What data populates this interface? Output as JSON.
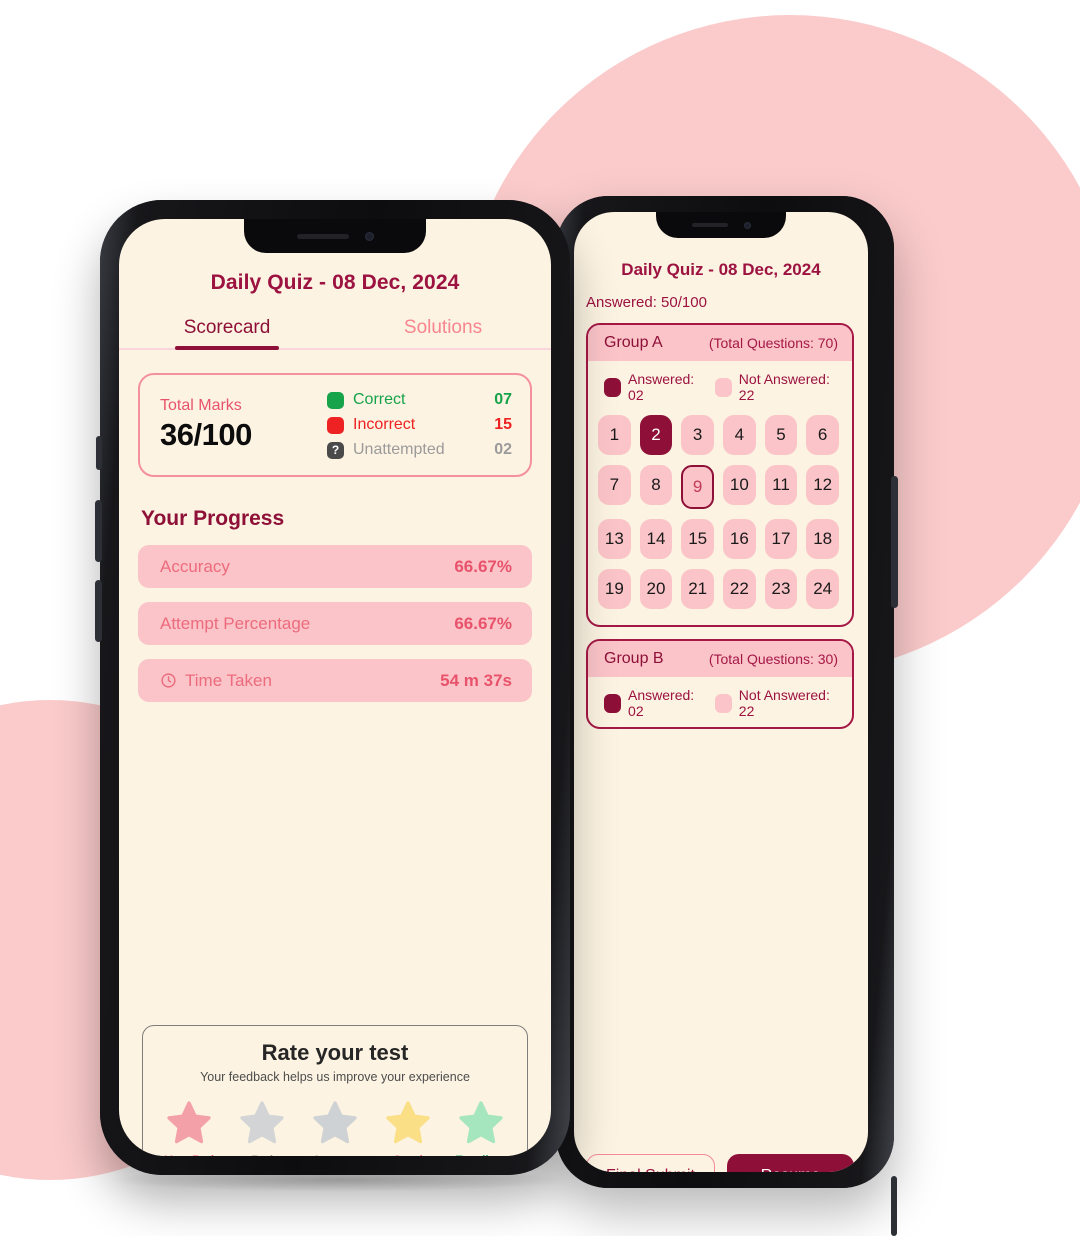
{
  "theme": {
    "brand_maroon": "#8E1038",
    "brand_pink": "#FBC4C9",
    "screen_bg": "#FCF3E2",
    "circle_pink": "#FBCBCB",
    "correct_green": "#16A34A",
    "incorrect_red": "#EE2222",
    "unattempted_gray": "#9A9A9A"
  },
  "scorecard_screen": {
    "title": "Daily Quiz - 08 Dec, 2024",
    "tabs": [
      {
        "label": "Scorecard",
        "active": true
      },
      {
        "label": "Solutions",
        "active": false
      }
    ],
    "score_card": {
      "total_marks_label": "Total Marks",
      "total_marks_value": "36/100",
      "legend": [
        {
          "label": "Correct",
          "count": "07",
          "color": "#16A34A",
          "icon": "filled-square-icon"
        },
        {
          "label": "Incorrect",
          "count": "15",
          "color": "#EE2222",
          "icon": "filled-square-icon"
        },
        {
          "label": "Unattempted",
          "count": "02",
          "color": "#9A9A9A",
          "icon": "question-mark-icon"
        }
      ]
    },
    "progress": {
      "section_title": "Your Progress",
      "rows": [
        {
          "label": "Accuracy",
          "value": "66.67%",
          "icon": null
        },
        {
          "label": "Attempt Percentage",
          "value": "66.67%",
          "icon": null
        },
        {
          "label": "Time Taken",
          "value": "54 m 37s",
          "icon": "clock-icon"
        }
      ]
    },
    "rating": {
      "title": "Rate your test",
      "subtitle": "Your feedback helps us improve your experience",
      "options": [
        {
          "label": "Very Bad",
          "star_color": "#F4A0A8",
          "text_color": "#F4536B"
        },
        {
          "label": "Bad",
          "star_color": "#D2D4D6",
          "text_color": "#9B9B9B"
        },
        {
          "label": "Average",
          "star_color": "#CFD2D4",
          "text_color": "#9B9B9B"
        },
        {
          "label": "Good",
          "star_color": "#FADF86",
          "text_color": "#EE6B7E"
        },
        {
          "label": "Excellent",
          "star_color": "#A5E6BE",
          "text_color": "#2FA86B"
        }
      ]
    }
  },
  "question_palette_screen": {
    "title": "Daily Quiz - 08 Dec, 2024",
    "answered_summary": "Answered: 50/100",
    "groups": [
      {
        "name": "Group A",
        "total_questions": "(Total Questions: 70)",
        "legend": [
          {
            "label": "Answered: 02",
            "swatch": "dark"
          },
          {
            "label": "Not Answered: 22",
            "swatch": "pink"
          }
        ],
        "questions": [
          {
            "n": "1",
            "state": "pink"
          },
          {
            "n": "2",
            "state": "selected"
          },
          {
            "n": "3",
            "state": "pink"
          },
          {
            "n": "4",
            "state": "pink"
          },
          {
            "n": "5",
            "state": "pink"
          },
          {
            "n": "6",
            "state": "pink"
          },
          {
            "n": "7",
            "state": "pink"
          },
          {
            "n": "8",
            "state": "pink"
          },
          {
            "n": "9",
            "state": "marked"
          },
          {
            "n": "10",
            "state": "pink"
          },
          {
            "n": "11",
            "state": "pink"
          },
          {
            "n": "12",
            "state": "pink"
          },
          {
            "n": "13",
            "state": "pink"
          },
          {
            "n": "14",
            "state": "pink"
          },
          {
            "n": "15",
            "state": "pink"
          },
          {
            "n": "16",
            "state": "pink"
          },
          {
            "n": "17",
            "state": "pink"
          },
          {
            "n": "18",
            "state": "pink"
          },
          {
            "n": "19",
            "state": "pink"
          },
          {
            "n": "20",
            "state": "pink"
          },
          {
            "n": "21",
            "state": "pink"
          },
          {
            "n": "22",
            "state": "pink"
          },
          {
            "n": "23",
            "state": "pink"
          },
          {
            "n": "24",
            "state": "pink"
          }
        ]
      },
      {
        "name": "Group B",
        "total_questions": "(Total Questions: 30)",
        "legend": [
          {
            "label": "Answered: 02",
            "swatch": "dark"
          },
          {
            "label": "Not Answered: 22",
            "swatch": "pink"
          }
        ],
        "questions": []
      }
    ],
    "actions": [
      {
        "label": "Final Submit",
        "style": "outline"
      },
      {
        "label": "Resume",
        "style": "solid"
      }
    ]
  }
}
